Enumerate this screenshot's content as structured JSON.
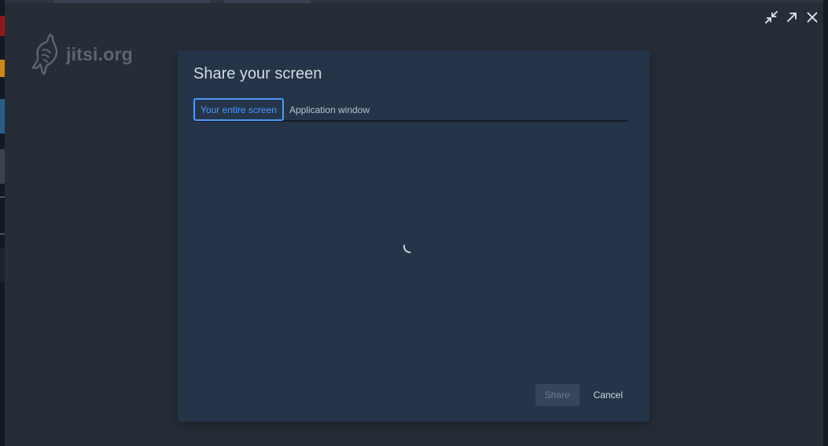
{
  "watermark": {
    "text": "jitsi.org",
    "logo_icon": "jitsi-logo-icon"
  },
  "window_controls": [
    {
      "name": "exit-fullscreen-icon"
    },
    {
      "name": "expand-icon"
    },
    {
      "name": "close-icon"
    }
  ],
  "dialog": {
    "title": "Share your screen",
    "tabs": [
      {
        "label": "Your entire screen",
        "active": true
      },
      {
        "label": "Application window",
        "active": false
      }
    ],
    "loading": true,
    "buttons": {
      "share_label": "Share",
      "share_disabled": true,
      "cancel_label": "Cancel"
    }
  },
  "colors": {
    "dialog_bg": "#253449",
    "accent": "#4c9aff",
    "backdrop": "#272d37"
  }
}
